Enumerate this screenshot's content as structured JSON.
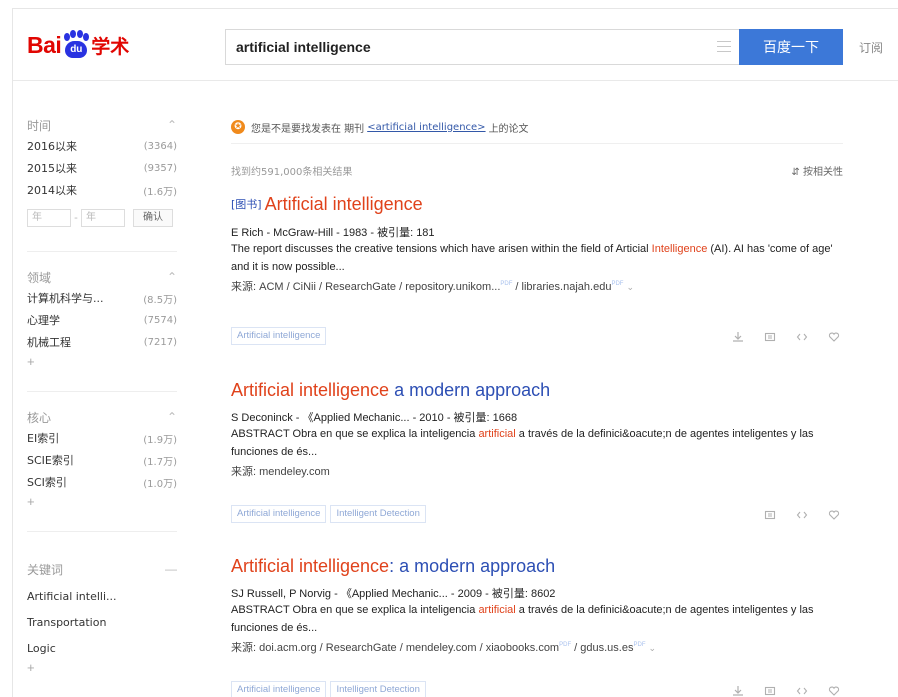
{
  "header": {
    "logo_bai": "Bai",
    "logo_du": "du",
    "logo_xueshu": "学术",
    "search_value": "artificial intelligence",
    "search_button": "百度一下",
    "subscribe": "订阅"
  },
  "sidebar": {
    "time": {
      "title": "时间",
      "items": [
        {
          "label": "2016以来",
          "count": "(3364)"
        },
        {
          "label": "2015以来",
          "count": "(9357)"
        },
        {
          "label": "2014以来",
          "count": "(1.6万)"
        }
      ],
      "range_from": "年",
      "range_to": "年",
      "confirm": "确认"
    },
    "field": {
      "title": "领域",
      "items": [
        {
          "label": "计算机科学与...",
          "count": "(8.5万)"
        },
        {
          "label": "心理学",
          "count": "(7574)"
        },
        {
          "label": "机械工程",
          "count": "(7217)"
        }
      ],
      "more": "+"
    },
    "core": {
      "title": "核心",
      "items": [
        {
          "label": "EI索引",
          "count": "(1.9万)"
        },
        {
          "label": "SCIE索引",
          "count": "(1.7万)"
        },
        {
          "label": "SCI索引",
          "count": "(1.0万)"
        }
      ],
      "more": "+"
    },
    "keywords": {
      "title": "关键词",
      "items": [
        {
          "label": "Artificial intelli..."
        },
        {
          "label": "Transportation"
        },
        {
          "label": "Logic"
        }
      ],
      "more": "+"
    }
  },
  "main": {
    "notice_pre": "您是不是要找发表在 期刊",
    "notice_link": "<artificial intelligence>",
    "notice_post": "上的论文",
    "result_count": "找到约591,000条相关结果",
    "sort": "按相关性",
    "results": [
      {
        "tag": "[图书]",
        "title_hl": "Artificial intelligence",
        "title_rest": "",
        "meta": "E Rich - McGraw-Hill - 1983 - 被引量: 181",
        "abstract_1": "The report discusses the creative tensions which have arisen within the field of Articial ",
        "abstract_hl": "Intelligence",
        "abstract_2": " (AI). AI has 'come of age' and it is now possible...",
        "source": "来源: ACM / CiNii / ResearchGate / repository.unikom...",
        "source_2": " / libraries.najah.edu",
        "pdf": "PDF",
        "keywords": [
          "Artificial intelligence"
        ]
      },
      {
        "tag": "",
        "title_hl": "Artificial intelligence",
        "title_rest": " a modern approach",
        "meta": "S Deconinck - 《Applied Mechanic... - 2010 - 被引量: 1668",
        "abstract_1": "ABSTRACT Obra en que se explica la inteligencia ",
        "abstract_hl": "artificial",
        "abstract_2": " a través de la definici&oacute;n de agentes inteligentes y las funciones de és...",
        "source": "来源: mendeley.com",
        "source_2": "",
        "pdf": "",
        "keywords": [
          "Artificial intelligence",
          "Intelligent Detection"
        ]
      },
      {
        "tag": "",
        "title_hl": "Artificial intelligence",
        "title_rest": ": a modern approach",
        "meta": "SJ Russell, P Norvig - 《Applied Mechanic... - 2009 - 被引量: 8602",
        "abstract_1": "ABSTRACT Obra en que se explica la inteligencia ",
        "abstract_hl": "artificial",
        "abstract_2": " a través de la definici&oacute;n de agentes inteligentes y las funciones de és...",
        "source": "来源: doi.acm.org / ResearchGate / mendeley.com / xiaobooks.com",
        "source_2": " / gdus.us.es",
        "pdf": "PDF",
        "keywords": [
          "Artificial intelligence",
          "Intelligent Detection"
        ]
      }
    ]
  },
  "colors": {
    "brand_red": "#e10602",
    "brand_blue": "#2932e1",
    "button_blue": "#3c78d8",
    "highlight": "#e0421b",
    "link_blue": "#2d4fb4",
    "notice_orange": "#f08a1c"
  },
  "icons": [
    "paw-icon",
    "lines-icon",
    "notice-icon",
    "download-icon",
    "cite-icon",
    "code-icon",
    "heart-icon"
  ]
}
